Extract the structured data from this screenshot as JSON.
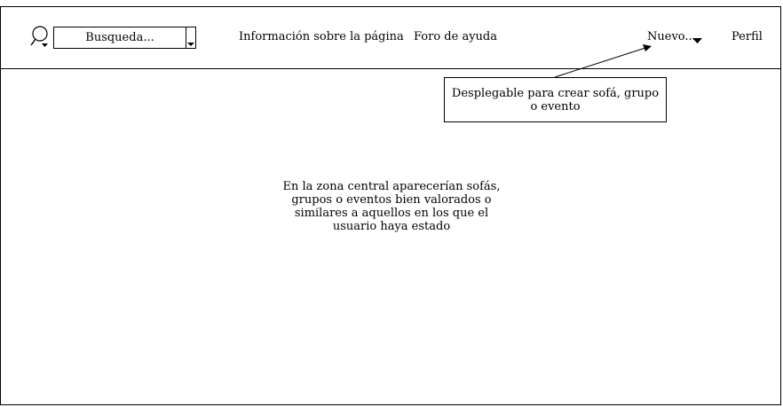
{
  "header": {
    "search": {
      "placeholder": "Busqueda..."
    },
    "nav": {
      "info_label": "Información sobre la página",
      "forum_label": "Foro de ayuda",
      "new_label": "Nuevo...",
      "profile_label": "Perfil"
    }
  },
  "annotations": {
    "dropdown_note": "Desplegable para crear sofá, grupo o evento"
  },
  "main": {
    "center_note": "En la zona central aparecerían sofás, grupos o eventos bien valorados o similares a aquellos en los que el usuario haya estado"
  },
  "icons": {
    "search": "magnifier-icon",
    "dropdown": "caret-down-icon"
  },
  "colors": {
    "stroke": "#000000",
    "background": "#ffffff"
  }
}
